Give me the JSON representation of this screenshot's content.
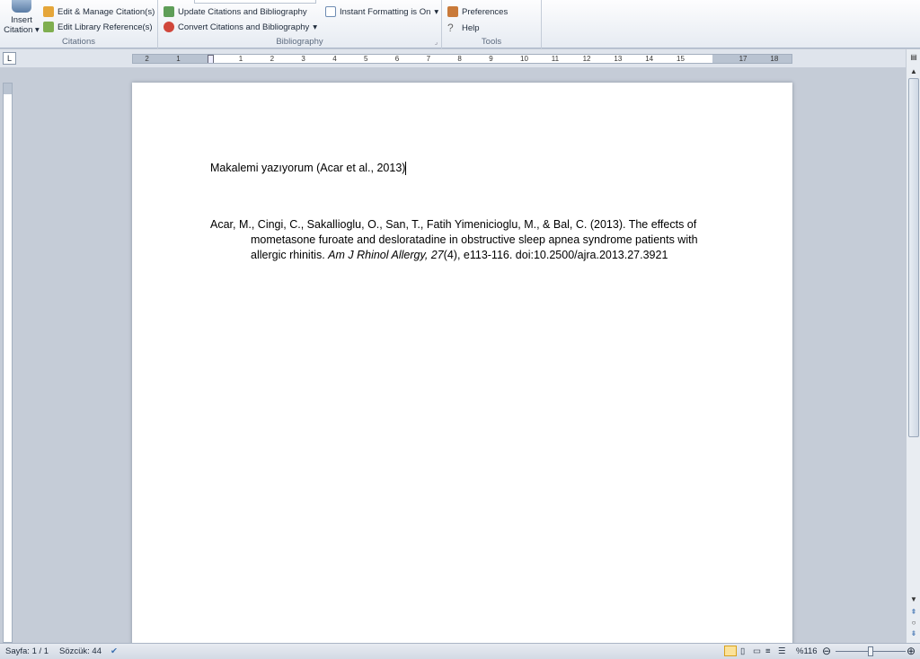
{
  "ribbon": {
    "citations": {
      "insert_line1": "Insert",
      "insert_line2": "Citation",
      "edit_manage": "Edit & Manage Citation(s)",
      "edit_library": "Edit Library Reference(s)",
      "label": "Citations"
    },
    "bibliography": {
      "update": "Update Citations and Bibliography",
      "convert": "Convert Citations and Bibliography",
      "instant": "Instant Formatting is On",
      "label": "Bibliography"
    },
    "tools": {
      "preferences": "Preferences",
      "help": "Help",
      "label": "Tools"
    }
  },
  "ruler": {
    "tab_selector": "L",
    "h_ticks": [
      "2",
      "1",
      "1",
      "2",
      "3",
      "4",
      "5",
      "6",
      "7",
      "8",
      "9",
      "10",
      "11",
      "12",
      "13",
      "14",
      "15",
      "17",
      "18"
    ]
  },
  "document": {
    "body_text": "Makalemi yazıyorum (Acar et al., 2013)",
    "reference": {
      "line1": "Acar, M., Cingi, C., Sakallioglu, O., San, T., Fatih Yimenicioglu, M., & Bal, C. (2013). The effects of",
      "line2": "mometasone furoate and desloratadine in obstructive sleep apnea syndrome patients with",
      "line3_pre": "allergic rhinitis. ",
      "line3_journal": "Am J Rhinol Allergy, 27",
      "line3_post": "(4), e113-116. doi:10.2500/ajra.2013.27.3921"
    }
  },
  "status": {
    "page": "Sayfa: 1 / 1",
    "words": "Sözcük: 44",
    "zoom": "%116",
    "zoom_percent": 116
  }
}
